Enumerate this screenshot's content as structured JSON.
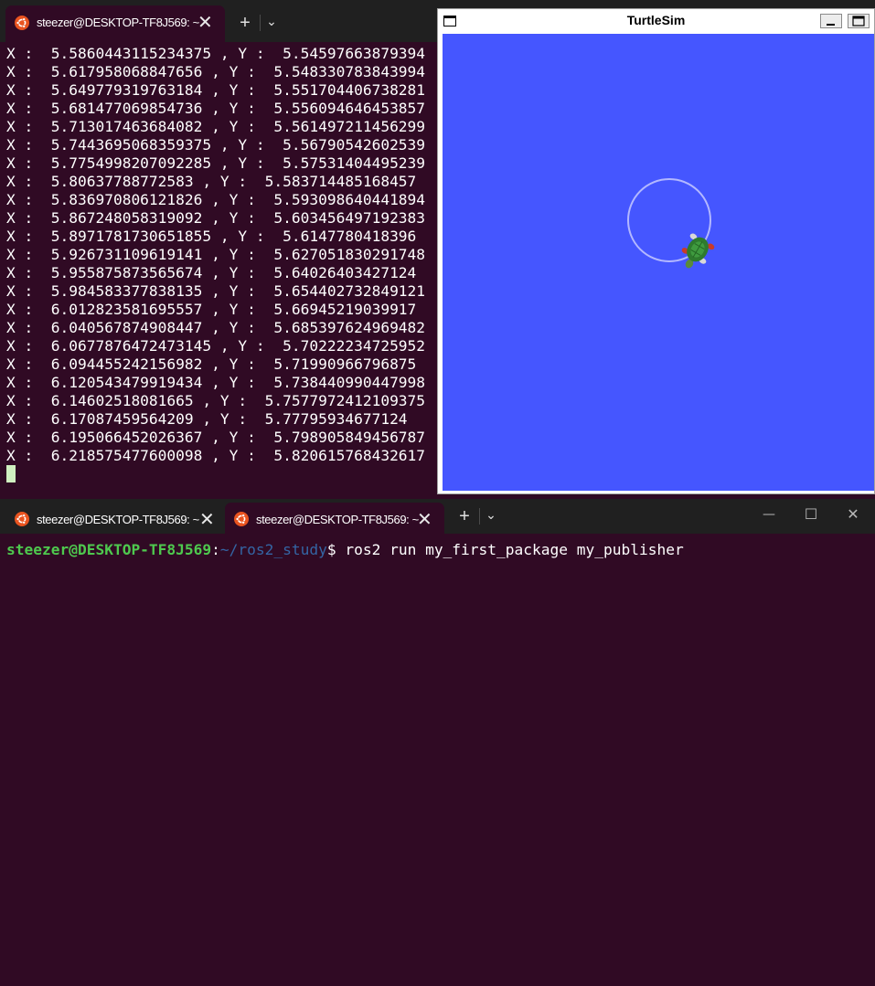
{
  "top_terminal": {
    "tabs": [
      {
        "label": "steezer@DESKTOP-TF8J569: ~",
        "active": true
      }
    ],
    "new_tab_label": "+",
    "dropdown_label": "⌄",
    "close_label": "✕",
    "output_lines": [
      "X :  5.5860443115234375 , Y :  5.54597663879394",
      "X :  5.617958068847656 , Y :  5.548330783843994",
      "X :  5.649779319763184 , Y :  5.551704406738281",
      "X :  5.681477069854736 , Y :  5.556094646453857",
      "X :  5.713017463684082 , Y :  5.561497211456299",
      "X :  5.7443695068359375 , Y :  5.56790542602539",
      "X :  5.7754998207092285 , Y :  5.57531404495239",
      "X :  5.80637788772583 , Y :  5.583714485168457",
      "X :  5.836970806121826 , Y :  5.593098640441894",
      "X :  5.867248058319092 , Y :  5.603456497192383",
      "X :  5.8971781730651855 , Y :  5.6147780418396",
      "X :  5.926731109619141 , Y :  5.627051830291748",
      "X :  5.955875873565674 , Y :  5.64026403427124",
      "X :  5.984583377838135 , Y :  5.654402732849121",
      "X :  6.012823581695557 , Y :  5.66945219039917",
      "X :  6.040567874908447 , Y :  5.685397624969482",
      "X :  6.0677876472473145 , Y :  5.70222234725952",
      "X :  6.094455242156982 , Y :  5.71990966796875",
      "X :  6.120543479919434 , Y :  5.738440990447998",
      "X :  6.14602518081665 , Y :  5.7577972412109375",
      "X :  6.17087459564209 , Y :  5.77795934677124",
      "X :  6.195066452026367 , Y :  5.798905849456787",
      "X :  6.218575477600098 , Y :  5.820615768432617"
    ]
  },
  "turtlesim": {
    "title": "TurtleSim",
    "background_color": "#4556ff",
    "pen_color": "#b3b8ff",
    "icons": [
      "window-icon",
      "minimize-icon",
      "maximize-icon",
      "turtle-icon"
    ]
  },
  "bottom_terminal": {
    "tabs": [
      {
        "label": "steezer@DESKTOP-TF8J569: ~",
        "active": false
      },
      {
        "label": "steezer@DESKTOP-TF8J569: ~",
        "active": true
      }
    ],
    "new_tab_label": "+",
    "dropdown_label": "⌄",
    "close_label": "✕",
    "window_controls": {
      "minimize": "—",
      "maximize": "☐",
      "close": "✕"
    },
    "prompt": {
      "user_host": "steezer@DESKTOP-TF8J569",
      "colon": ":",
      "path": "~/ros2_study",
      "symbol": "$ ",
      "command": "ros2 run my_first_package my_publisher"
    }
  }
}
